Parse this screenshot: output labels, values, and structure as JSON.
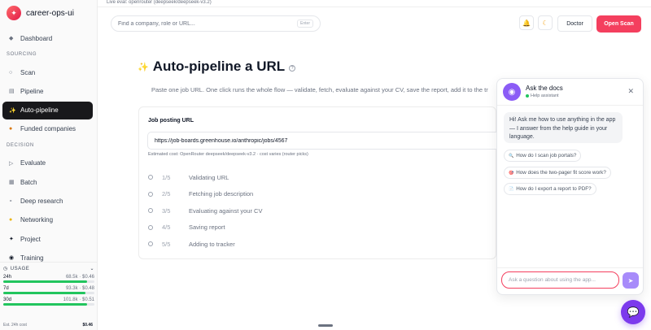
{
  "app": {
    "name": "career-ops-ui"
  },
  "sidebar": {
    "top_items": [
      {
        "label": "Dashboard",
        "icon": "diamond-icon"
      }
    ],
    "sections": [
      {
        "title": "SOURCING",
        "items": [
          {
            "label": "Scan",
            "icon": "search-icon"
          },
          {
            "label": "Pipeline",
            "icon": "grid-icon"
          },
          {
            "label": "Auto-pipeline",
            "icon": "sparkles-icon",
            "active": true
          },
          {
            "label": "Funded companies",
            "icon": "money-bag-icon"
          }
        ]
      },
      {
        "title": "DECISION",
        "items": [
          {
            "label": "Evaluate",
            "icon": "play-icon"
          },
          {
            "label": "Batch",
            "icon": "batch-icon"
          },
          {
            "label": "Deep research",
            "icon": "research-icon"
          },
          {
            "label": "Networking",
            "icon": "handshake-icon"
          },
          {
            "label": "Project",
            "icon": "project-icon"
          },
          {
            "label": "Training",
            "icon": "training-icon"
          }
        ]
      }
    ],
    "usage": {
      "title": "USAGE",
      "rows": [
        {
          "period": "24h",
          "tokens": "68.5k",
          "cost": "$0.46",
          "fill": 0.92
        },
        {
          "period": "7d",
          "tokens": "93.3k",
          "cost": "$0.48",
          "fill": 0.9
        },
        {
          "period": "30d",
          "tokens": "101.8k",
          "cost": "$0.51",
          "fill": 0.92
        }
      ],
      "footer_label": "Est. 24h cost",
      "footer_value": "$0.46"
    }
  },
  "header": {
    "live_eval": "Live eval: openrouter (deepseek/deepseek-v3.2)",
    "search_placeholder": "Find a company, role or URL...",
    "search_kbd": "Enter",
    "doctor_label": "Doctor",
    "open_scan_label": "Open Scan"
  },
  "main": {
    "title": "Auto-pipeline a URL",
    "subtitle": "Paste one job URL. One click runs the whole flow — validate, fetch, evaluate against your CV, save the report, add it to the tr",
    "card": {
      "label": "Job posting URL",
      "url_value": "https://job-boards.greenhouse.io/anthropic/jobs/4567",
      "estimated": "Estimated cost: OpenRouter deepseek/deepseek-v3.2 · cost varies (router picks)",
      "steps": [
        {
          "num": "1/5",
          "label": "Validating URL"
        },
        {
          "num": "2/5",
          "label": "Fetching job description"
        },
        {
          "num": "3/5",
          "label": "Evaluating against your CV"
        },
        {
          "num": "4/5",
          "label": "Saving report"
        },
        {
          "num": "5/5",
          "label": "Adding to tracker"
        }
      ]
    }
  },
  "chat": {
    "title": "Ask the docs",
    "status": "Help assistant",
    "greeting": "Hi! Ask me how to use anything in the app — I answer from the help guide in your language.",
    "suggestions": [
      {
        "label": "How do I scan job portals?",
        "icon": "search-icon"
      },
      {
        "label": "How does the two-pager fit score work?",
        "icon": "target-icon"
      },
      {
        "label": "How do I export a report to PDF?",
        "icon": "document-icon"
      }
    ],
    "input_placeholder": "Ask a question about using the app..."
  }
}
